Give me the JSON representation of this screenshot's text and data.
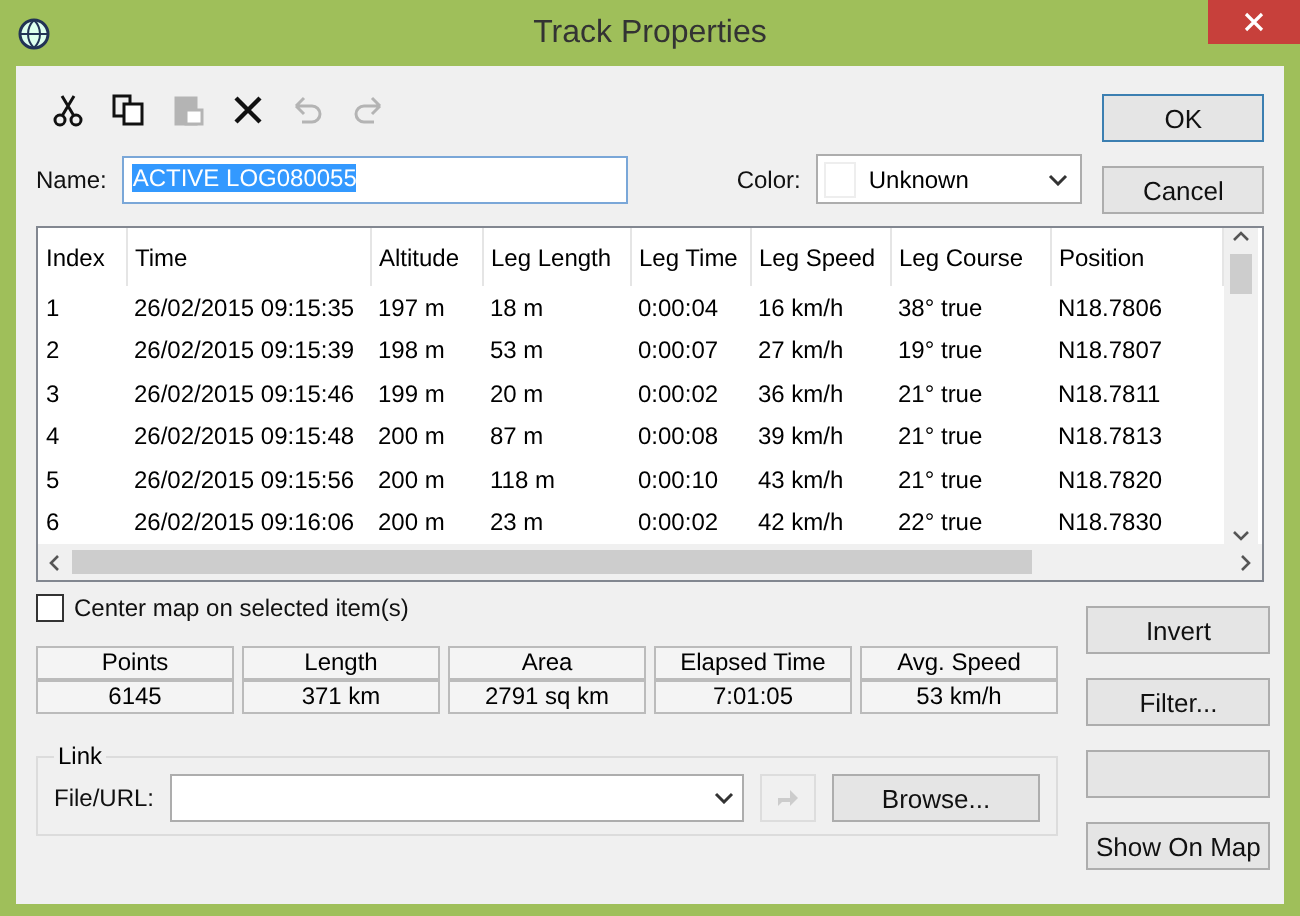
{
  "window": {
    "title": "Track Properties"
  },
  "toolbar": [
    {
      "kind": "cut",
      "disabled": false
    },
    {
      "kind": "copy",
      "disabled": false
    },
    {
      "kind": "paste",
      "disabled": true
    },
    {
      "kind": "delete",
      "disabled": false
    },
    {
      "kind": "undo",
      "disabled": true
    },
    {
      "kind": "redo",
      "disabled": true
    }
  ],
  "name": {
    "label": "Name:",
    "value": "ACTIVE LOG080055"
  },
  "color": {
    "label": "Color:",
    "value": "Unknown"
  },
  "buttons_top": [
    "OK",
    "Cancel"
  ],
  "table": {
    "columns": [
      "Index",
      "Time",
      "Altitude",
      "Leg Length",
      "Leg Time",
      "Leg Speed",
      "Leg Course",
      "Position"
    ],
    "rows": [
      [
        "1",
        "26/02/2015 09:15:35",
        "197 m",
        "18 m",
        "0:00:04",
        "16 km/h",
        "38° true",
        "N18.7806"
      ],
      [
        "2",
        "26/02/2015 09:15:39",
        "198 m",
        "53 m",
        "0:00:07",
        "27 km/h",
        "19° true",
        "N18.7807"
      ],
      [
        "3",
        "26/02/2015 09:15:46",
        "199 m",
        "20 m",
        "0:00:02",
        "36 km/h",
        "21° true",
        "N18.7811"
      ],
      [
        "4",
        "26/02/2015 09:15:48",
        "200 m",
        "87 m",
        "0:00:08",
        "39 km/h",
        "21° true",
        "N18.7813"
      ],
      [
        "5",
        "26/02/2015 09:15:56",
        "200 m",
        "118 m",
        "0:00:10",
        "43 km/h",
        "21° true",
        "N18.7820"
      ],
      [
        "6",
        "26/02/2015 09:16:06",
        "200 m",
        "23 m",
        "0:00:02",
        "42 km/h",
        "22° true",
        "N18.7830"
      ]
    ]
  },
  "center_map": {
    "label": "Center map on selected item(s)",
    "checked": false
  },
  "stats": [
    {
      "label": "Points",
      "value": "6145"
    },
    {
      "label": "Length",
      "value": "371 km"
    },
    {
      "label": "Area",
      "value": "2791 sq km"
    },
    {
      "label": "Elapsed Time",
      "value": "7:01:05"
    },
    {
      "label": "Avg. Speed",
      "value": "53 km/h"
    }
  ],
  "link": {
    "title": "Link",
    "label": "File/URL:",
    "browse": "Browse..."
  },
  "buttons_side": [
    {
      "kind": "text",
      "label": "Invert"
    },
    {
      "kind": "text",
      "label": "Filter..."
    },
    {
      "kind": "blank"
    },
    {
      "kind": "text",
      "label": "Show On Map"
    }
  ]
}
